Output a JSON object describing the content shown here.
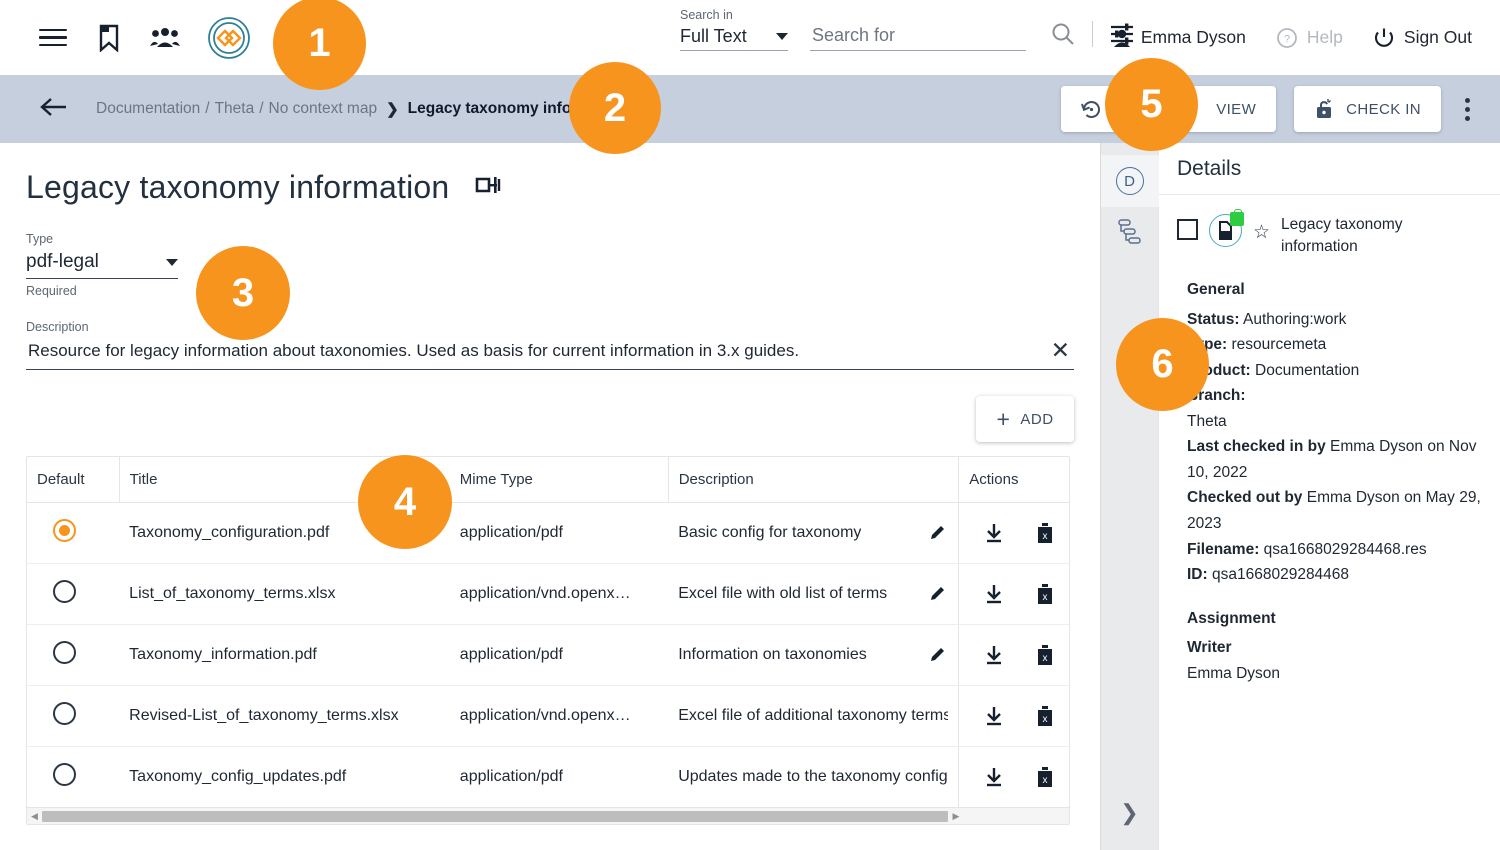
{
  "header": {
    "icons": [
      {
        "name": "menu-icon",
        "label": "Menu"
      },
      {
        "name": "bookmark-icon",
        "label": "Bookmarks"
      },
      {
        "name": "people-icon",
        "label": "People"
      },
      {
        "name": "app-logo-icon",
        "label": "Application logo"
      }
    ],
    "search": {
      "search_in_label": "Search in",
      "search_in_value": "Full Text",
      "search_for_placeholder": "Search for",
      "search_for_value": "",
      "search_icon": "search-icon",
      "filter_icon": "filter-settings-icon"
    },
    "user": {
      "name": "Emma Dyson",
      "help_label": "Help",
      "sign_out_label": "Sign Out"
    }
  },
  "breadcrumb": {
    "back_label": "Back",
    "items": [
      "Documentation",
      "Theta",
      "No context map"
    ],
    "current": "Legacy taxonomy information",
    "actions": {
      "revert_label": "REVERT",
      "view_label": "VIEW",
      "check_in_label": "CHECK IN",
      "more_label": "More options"
    }
  },
  "main": {
    "title": "Legacy taxonomy information",
    "title_icon": "resize-rename-icon",
    "type_field": {
      "label": "Type",
      "value": "pdf-legal",
      "hint": "Required"
    },
    "description_field": {
      "label": "Description",
      "value": "Resource for legacy information about taxonomies. Used as basis for current information in 3.x guides.",
      "placeholder": "Description",
      "clear_label": "✕"
    },
    "add_button": {
      "label": "ADD",
      "icon": "plus-icon"
    },
    "table": {
      "columns": [
        "Default",
        "Title",
        "Mime Type",
        "Description",
        "Actions"
      ],
      "rows": [
        {
          "default_selected": true,
          "title": "Taxonomy_configuration.pdf",
          "mime": "application/pdf",
          "description": "Basic config for taxonomy",
          "edit_icon": "pencil-icon",
          "download_icon": "download-icon",
          "delete_icon": "delete-icon"
        },
        {
          "default_selected": false,
          "title": "List_of_taxonomy_terms.xlsx",
          "mime": "application/vnd.openx…",
          "description": "Excel file with old list of terms",
          "edit_icon": "pencil-icon",
          "download_icon": "download-icon",
          "delete_icon": "delete-icon"
        },
        {
          "default_selected": false,
          "title": "Taxonomy_information.pdf",
          "mime": "application/pdf",
          "description": "Information on taxonomies",
          "edit_icon": "pencil-icon",
          "download_icon": "download-icon",
          "delete_icon": "delete-icon"
        },
        {
          "default_selected": false,
          "title": "Revised-List_of_taxonomy_terms.xlsx",
          "mime": "application/vnd.openx…",
          "description": "Excel file of additional taxonomy terms",
          "edit_icon": "pencil-icon",
          "download_icon": "download-icon",
          "delete_icon": "delete-icon"
        },
        {
          "default_selected": false,
          "title": "Taxonomy_config_updates.pdf",
          "mime": "application/pdf",
          "description": "Updates made to the taxonomy config",
          "edit_icon": "pencil-icon",
          "download_icon": "download-icon",
          "delete_icon": "delete-icon"
        }
      ]
    }
  },
  "rail": {
    "details_tab": "D",
    "hierarchy_icon": "hierarchy-tree-icon",
    "expand_icon": "chevron-right-icon"
  },
  "details": {
    "title": "Details",
    "resource_name": "Legacy taxonomy information",
    "checkbox_label": "Select resource",
    "doc_icon": "locked-document-icon",
    "star_icon": "star-outline-icon",
    "general_heading": "General",
    "fields": [
      {
        "label": "Status:",
        "value": "Authoring:work"
      },
      {
        "label": "Type:",
        "value": "resourcemeta"
      },
      {
        "label": "Product:",
        "value": "Documentation"
      },
      {
        "label": "Branch:",
        "value": "Theta"
      },
      {
        "label": "Last checked in by",
        "value": "Emma Dyson on Nov 10, 2022"
      },
      {
        "label": "Checked out by",
        "value": "Emma Dyson on May 29, 2023"
      },
      {
        "label": "Filename:",
        "value": "qsa1668029284468.res"
      },
      {
        "label": "ID:",
        "value": "qsa1668029284468"
      }
    ],
    "assignment_heading": "Assignment",
    "assignment_role": "Writer",
    "assignment_person": "Emma Dyson"
  },
  "badges": [
    {
      "id": "1",
      "label": "1"
    },
    {
      "id": "2",
      "label": "2"
    },
    {
      "id": "3",
      "label": "3"
    },
    {
      "id": "4",
      "label": "4"
    },
    {
      "id": "5",
      "label": "5"
    },
    {
      "id": "6",
      "label": "6"
    }
  ],
  "colors": {
    "badge_orange": "#f7941e",
    "breadcrumb_bar": "#c5cfde",
    "accent_blue": "#3f5068",
    "rail_bg": "#e9eaec",
    "lock_green": "#2ecc40",
    "ring_teal": "#4aa8c4"
  }
}
